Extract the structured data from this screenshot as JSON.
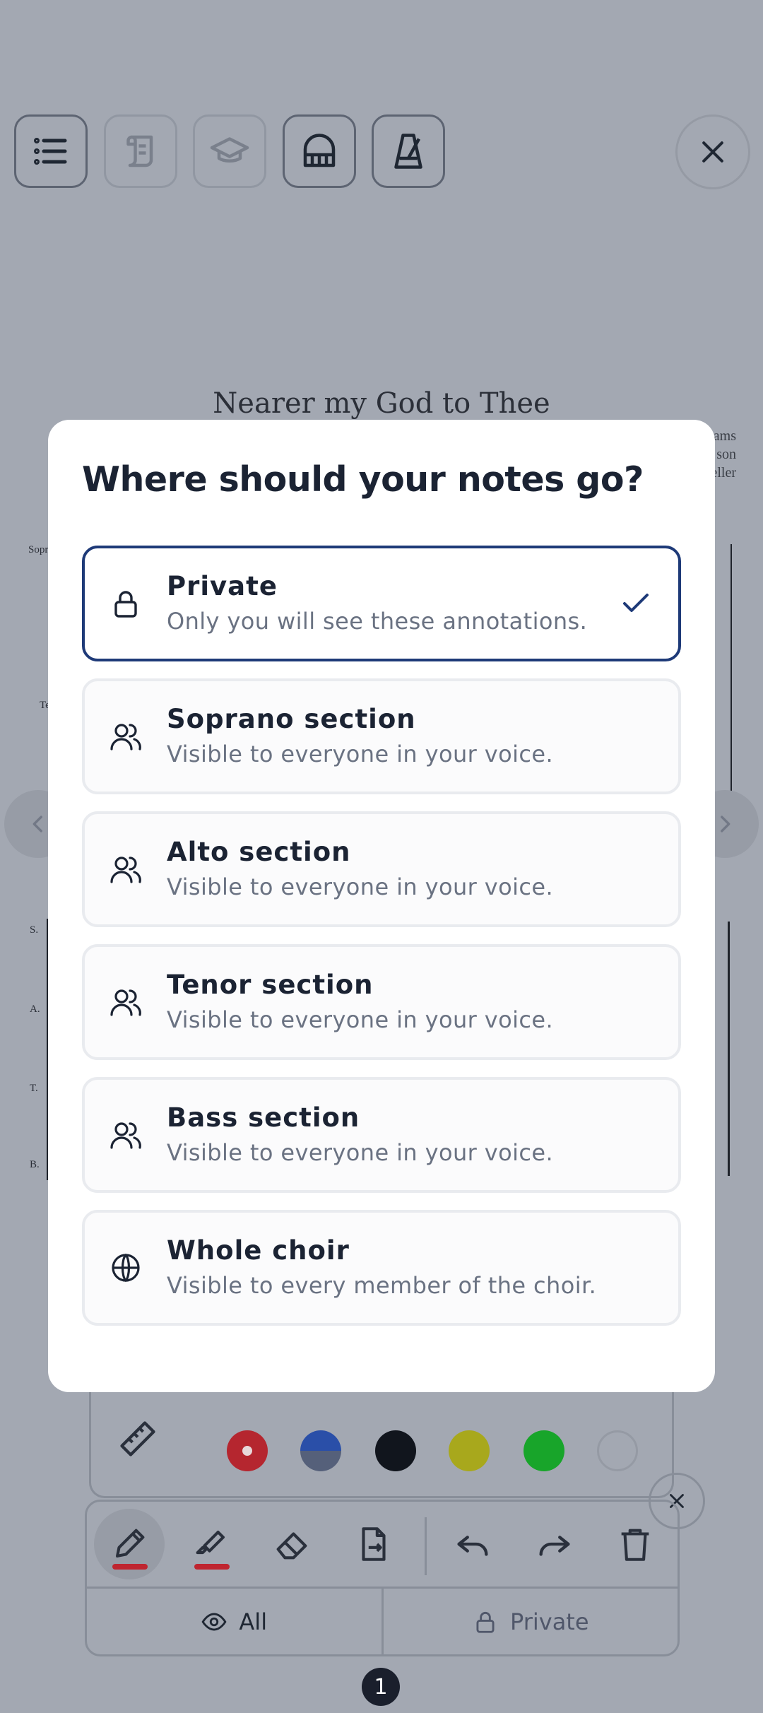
{
  "background": {
    "toolbar_icons": [
      "list-icon",
      "scroll-icon",
      "graduation-cap-icon",
      "piano-icon",
      "metronome-icon"
    ],
    "score_title": "Nearer my God to Thee",
    "credits": [
      "ams",
      "son",
      "eller"
    ],
    "voice_tags": [
      "Sopr",
      "Te",
      "S.",
      "A.",
      "T.",
      "B."
    ],
    "visibility_all_label": "All",
    "visibility_private_label": "Private",
    "page_number": "1",
    "swatch_colors": [
      "#b5262f",
      "#2a4fa8",
      "#11151d",
      "#a8a81c",
      "#18a52a",
      "#a3a8b2"
    ]
  },
  "modal": {
    "title": "Where should your notes go?",
    "options": [
      {
        "icon": "lock-icon",
        "title": "Private",
        "description": "Only you will see these annotations.",
        "selected": true
      },
      {
        "icon": "users-icon",
        "title": "Soprano section",
        "description": "Visible to everyone in your voice.",
        "selected": false
      },
      {
        "icon": "users-icon",
        "title": "Alto section",
        "description": "Visible to everyone in your voice.",
        "selected": false
      },
      {
        "icon": "users-icon",
        "title": "Tenor section",
        "description": "Visible to everyone in your voice.",
        "selected": false
      },
      {
        "icon": "users-icon",
        "title": "Bass section",
        "description": "Visible to everyone in your voice.",
        "selected": false
      },
      {
        "icon": "globe-icon",
        "title": "Whole choir",
        "description": "Visible to every member of the choir.",
        "selected": false
      }
    ]
  },
  "colors": {
    "accent": "#1e3a78",
    "backdrop": "#a3a8b2",
    "annotation_red": "#bf2530"
  }
}
